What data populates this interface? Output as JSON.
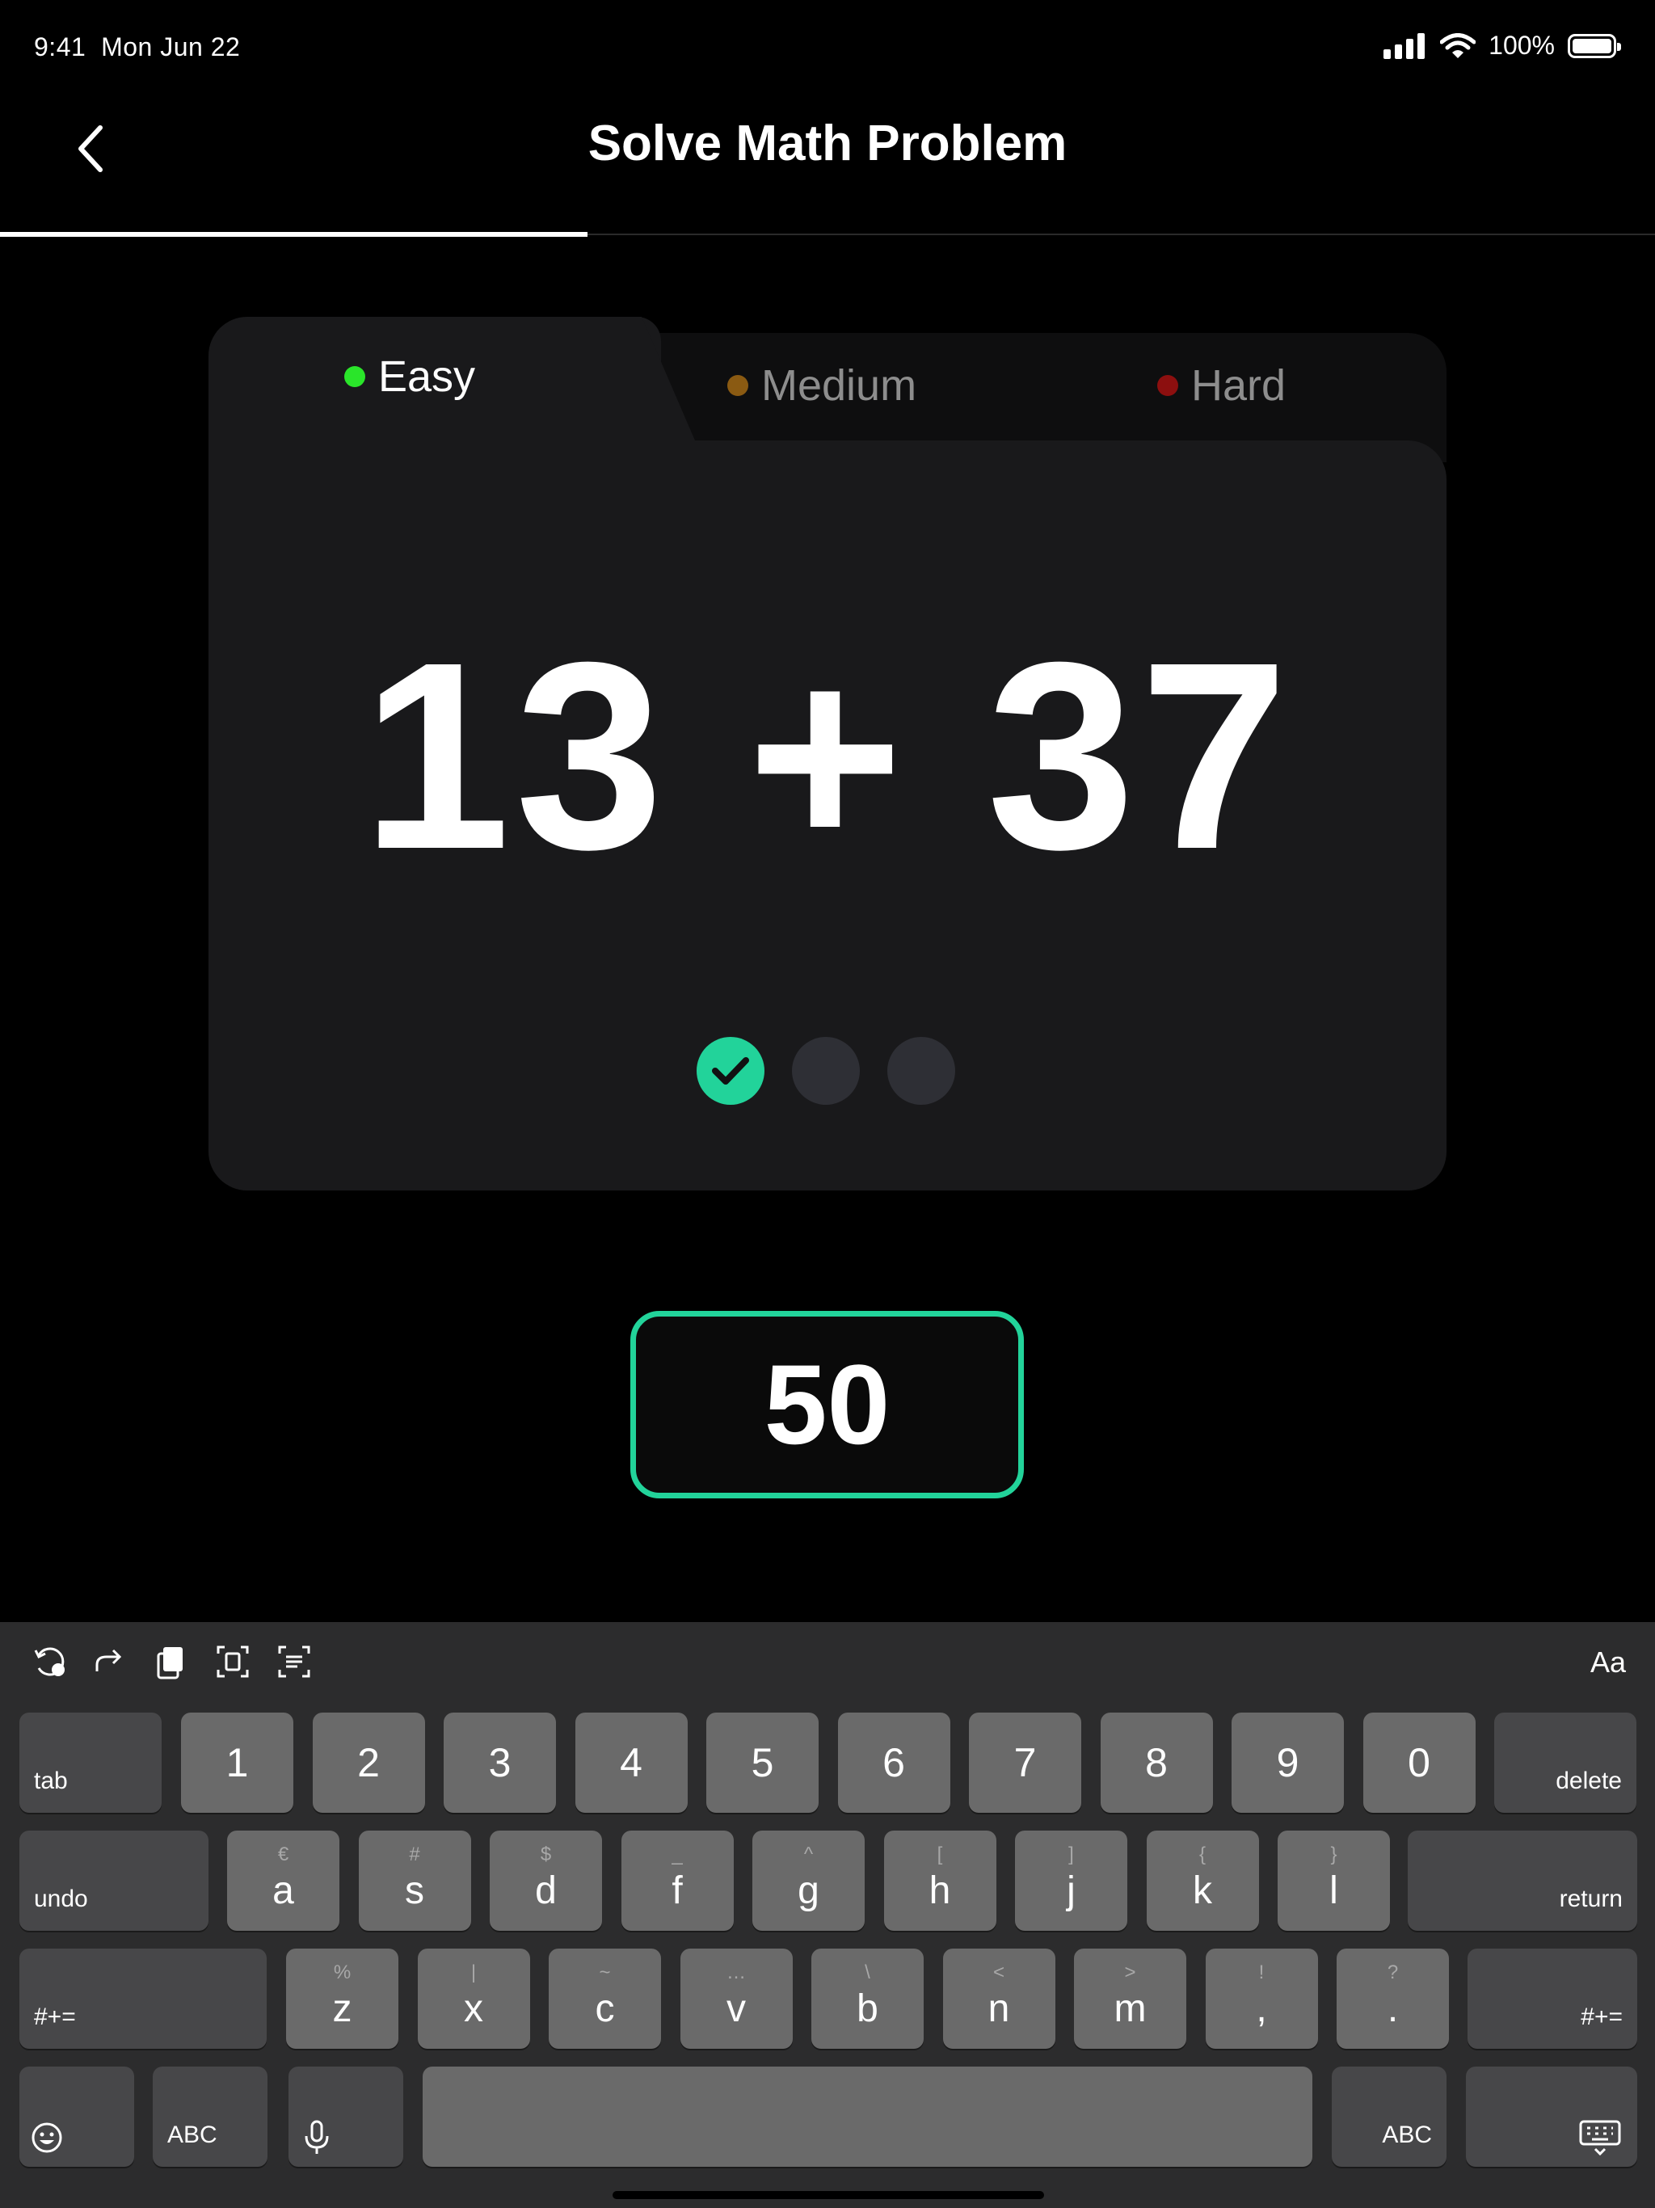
{
  "status": {
    "time": "9:41",
    "date": "Mon Jun 22",
    "battery": "100%"
  },
  "nav": {
    "title": "Solve Math Problem",
    "progress": 0.355
  },
  "difficulty": {
    "tabs": [
      {
        "label": "Easy",
        "color": "#2ae52a"
      },
      {
        "label": "Medium",
        "color": "#8a5a12"
      },
      {
        "label": "Hard",
        "color": "#8c0f0f"
      }
    ],
    "selected": "Easy"
  },
  "problem": {
    "expression": "13 + 37",
    "steps_total": 3,
    "steps_completed": 1
  },
  "answer": {
    "value": "50",
    "accent": "#22d39a"
  },
  "keyboard": {
    "toolbar_right": "Aa",
    "row1": [
      "1",
      "2",
      "3",
      "4",
      "5",
      "6",
      "7",
      "8",
      "9",
      "0"
    ],
    "row1_left": "tab",
    "row1_right": "delete",
    "row2": [
      {
        "k": "a",
        "s": "€"
      },
      {
        "k": "s",
        "s": "#"
      },
      {
        "k": "d",
        "s": "$"
      },
      {
        "k": "f",
        "s": "_"
      },
      {
        "k": "g",
        "s": "^"
      },
      {
        "k": "h",
        "s": "["
      },
      {
        "k": "j",
        "s": "]"
      },
      {
        "k": "k",
        "s": "{"
      },
      {
        "k": "l",
        "s": "}"
      }
    ],
    "row2_left": "undo",
    "row2_right": "return",
    "row3": [
      {
        "k": "z",
        "s": "%"
      },
      {
        "k": "x",
        "s": "|"
      },
      {
        "k": "c",
        "s": "~"
      },
      {
        "k": "v",
        "s": "…"
      },
      {
        "k": "b",
        "s": "\\"
      },
      {
        "k": "n",
        "s": "<"
      },
      {
        "k": "m",
        "s": ">"
      },
      {
        "k": ",",
        "s": "!"
      },
      {
        "k": ".",
        "s": "?"
      }
    ],
    "row3_left": "#+=",
    "row3_right": "#+=",
    "row4_abc": "ABC"
  }
}
